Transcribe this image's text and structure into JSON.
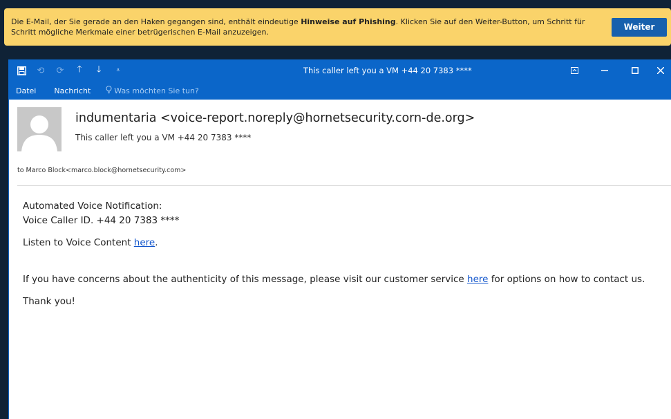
{
  "banner": {
    "text_before": "Die E-Mail, der Sie gerade an den Haken gegangen sind, enthält eindeutige ",
    "text_bold": "Hinweise auf Phishing",
    "text_after": ". Klicken Sie auf den Weiter-Button, um Schritt für Schritt mögliche Merkmale einer betrügerischen E-Mail anzuzeigen.",
    "button_label": "Weiter"
  },
  "window": {
    "title": "This caller left you a VM +44 20 7383 ****",
    "ribbon": {
      "tab_file": "Datei",
      "tab_message": "Nachricht",
      "tell_me": "Was möchten Sie tun?"
    }
  },
  "message": {
    "sender": "indumentaria <voice-report.noreply@hornetsecurity.corn-de.org>",
    "subject": "This caller left you a VM +44 20 7383 ****",
    "to": "to Marco Block<marco.block@hornetsecurity.com>",
    "line1": "Automated Voice Notification:",
    "line2": "Voice Caller ID. +44 20 7383 ****",
    "listen_text": "Listen to Voice Content ",
    "listen_link": "here",
    "listen_end": ".",
    "concern_text": "If you have concerns about the authenticity of this message, please visit our customer service ",
    "concern_link": "here",
    "concern_end": " for options on how to contact us.",
    "thanks": "Thank you!"
  },
  "colors": {
    "banner_bg": "#fad36a",
    "button_bg": "#1760ad",
    "titlebar_bg": "#0b66c9",
    "page_bg": "#0f2236",
    "link": "#1155cc"
  },
  "icons": [
    "save-icon",
    "undo-icon",
    "redo-icon",
    "up-arrow-icon",
    "down-arrow-icon",
    "customize-icon",
    "restore-ribbon-icon",
    "minimize-icon",
    "maximize-icon",
    "close-icon",
    "lightbulb-icon",
    "avatar-placeholder-icon"
  ]
}
